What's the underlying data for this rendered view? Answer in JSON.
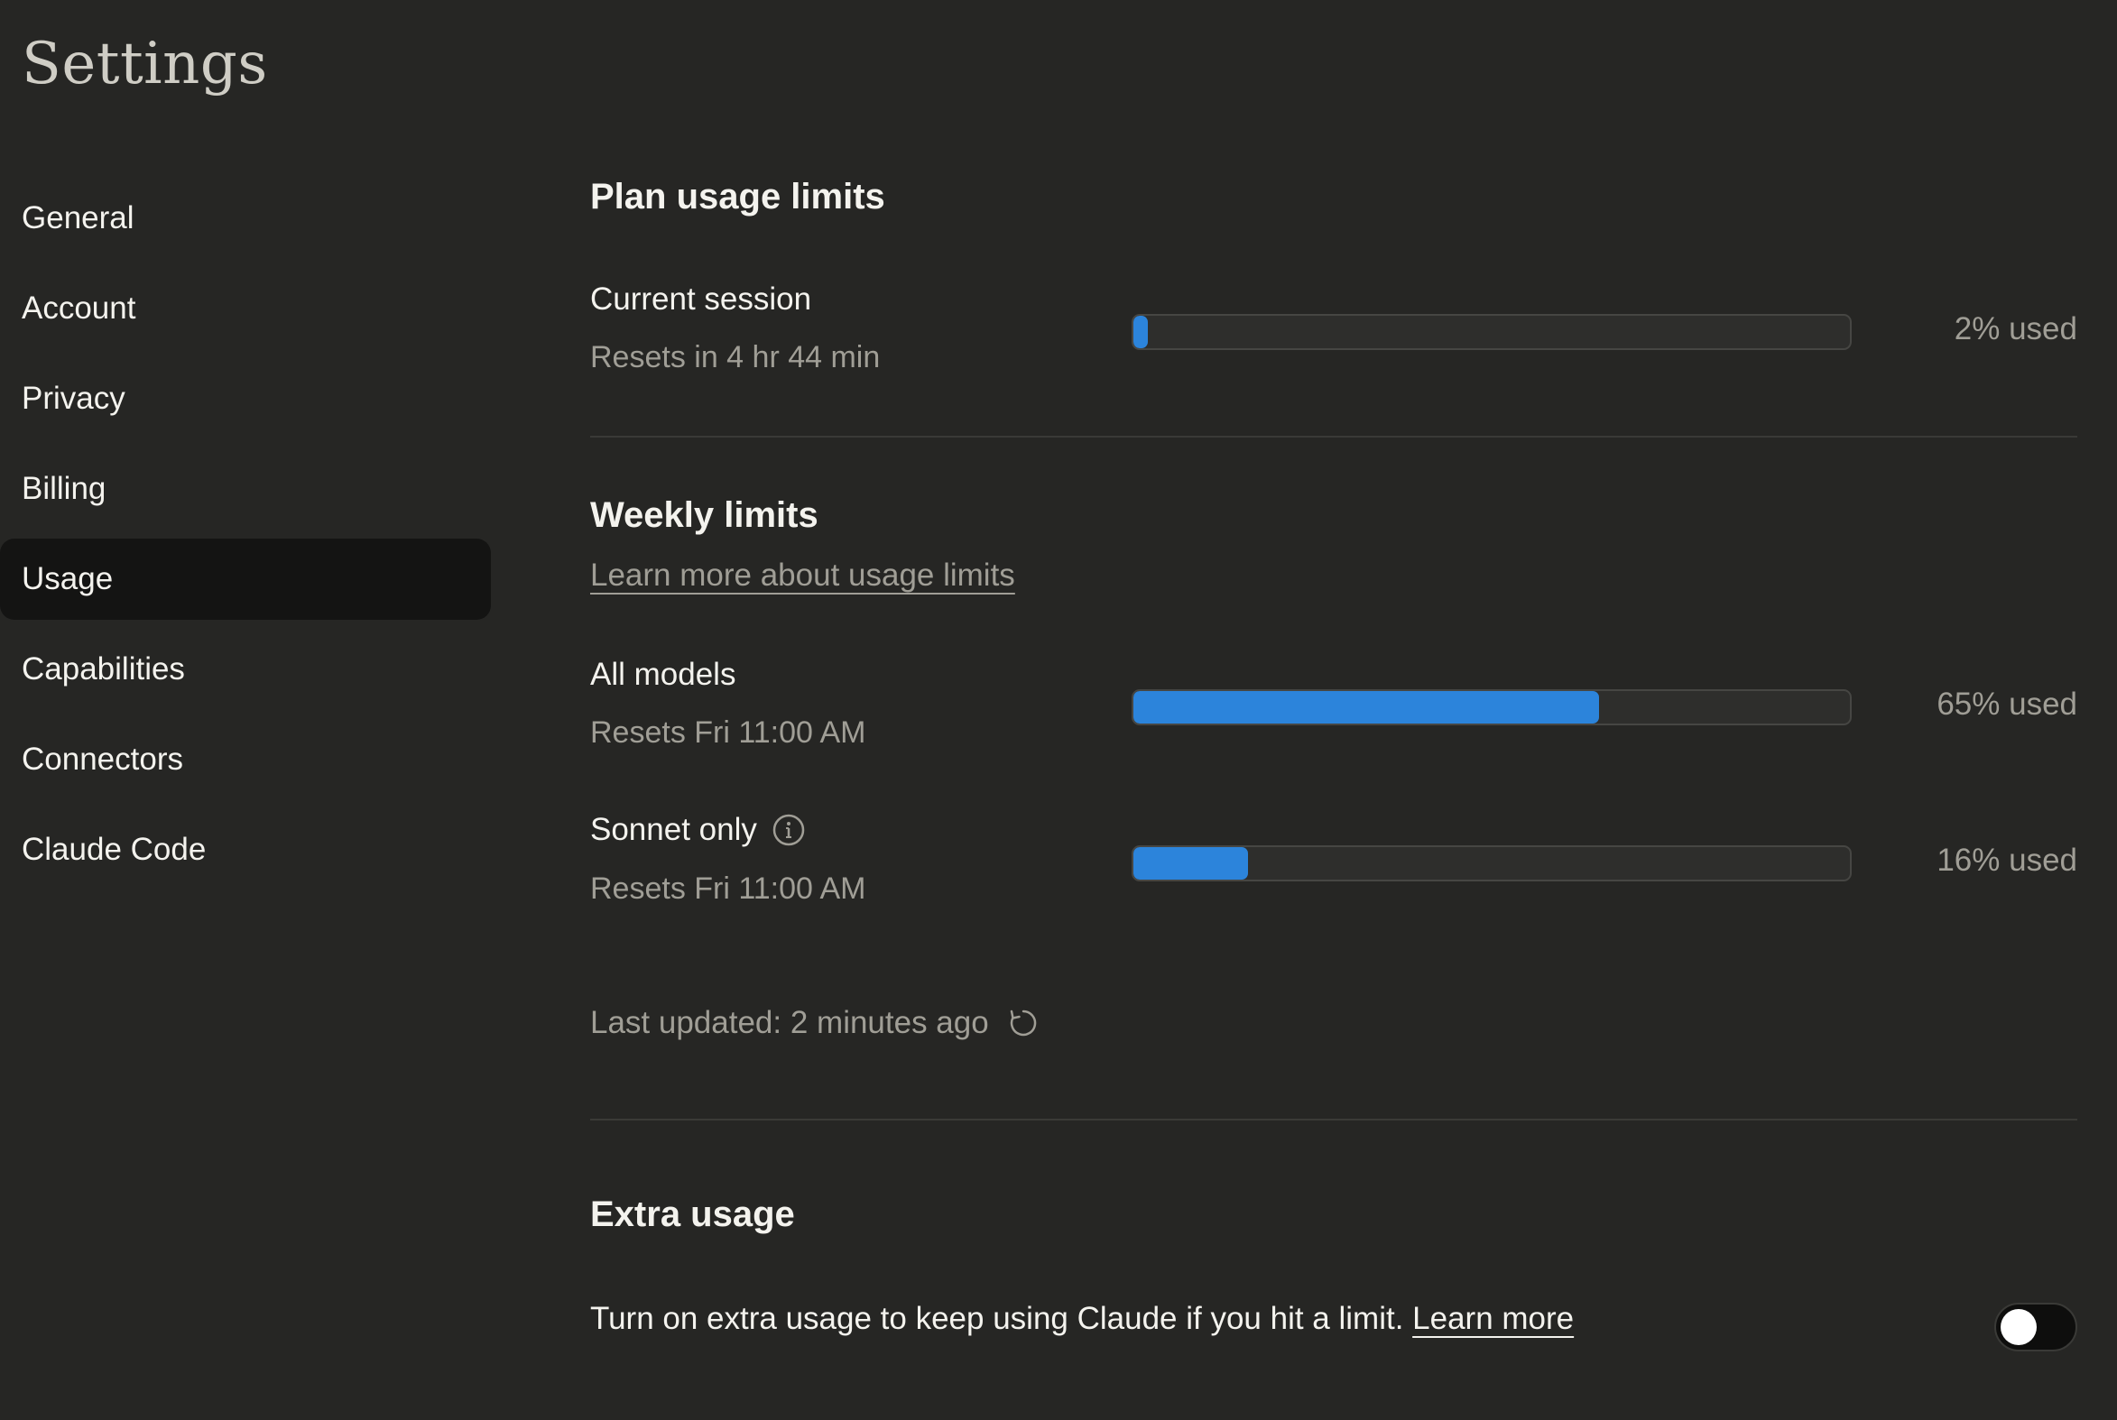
{
  "page": {
    "title": "Settings"
  },
  "sidebar": {
    "items": [
      {
        "label": "General"
      },
      {
        "label": "Account"
      },
      {
        "label": "Privacy"
      },
      {
        "label": "Billing"
      },
      {
        "label": "Usage",
        "active": true
      },
      {
        "label": "Capabilities"
      },
      {
        "label": "Connectors"
      },
      {
        "label": "Claude Code"
      }
    ]
  },
  "plan_limits": {
    "title": "Plan usage limits",
    "current_session": {
      "label": "Current session",
      "reset": "Resets in 4 hr 44 min",
      "percent": 2,
      "used_label": "2% used"
    }
  },
  "weekly_limits": {
    "title": "Weekly limits",
    "learn_more": "Learn more about usage limits",
    "all_models": {
      "label": "All models",
      "reset": "Resets Fri 11:00 AM",
      "percent": 65,
      "used_label": "65% used"
    },
    "sonnet_only": {
      "label": "Sonnet only",
      "reset": "Resets Fri 11:00 AM",
      "percent": 16,
      "used_label": "16% used",
      "icon": "info-icon"
    },
    "last_updated": "Last updated: 2 minutes ago",
    "refresh_icon": "refresh-icon"
  },
  "extra_usage": {
    "title": "Extra usage",
    "description": "Turn on extra usage to keep using Claude if you hit a limit.",
    "learn_more": "Learn more",
    "toggle_on": false
  },
  "colors": {
    "background": "#262624",
    "bar_fill": "#2c84db",
    "bar_track": "#2e2e2c",
    "active_nav": "#141413"
  }
}
